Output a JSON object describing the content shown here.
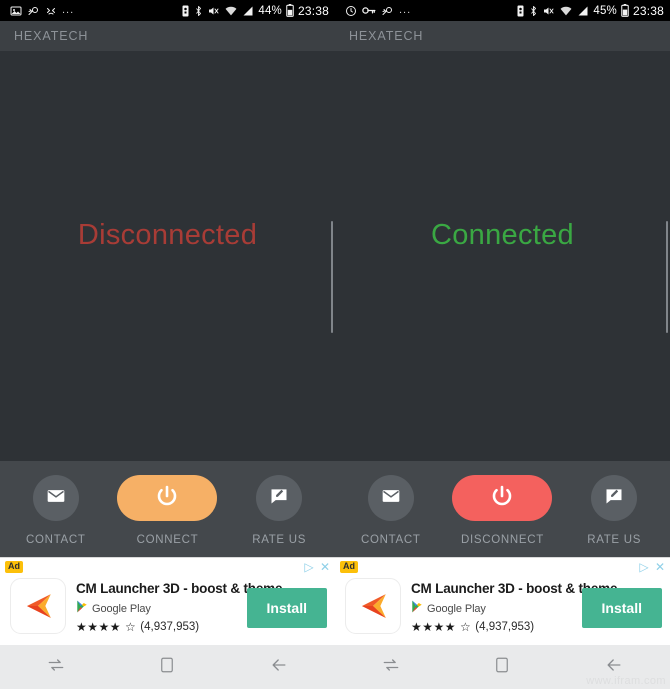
{
  "panes": [
    {
      "status_bar": {
        "left_icons": [
          "screenshot-icon",
          "mute-notification-icon",
          "face-icon"
        ],
        "overflow": "...",
        "right_icons": [
          "vibrate-icon",
          "bluetooth-icon",
          "speaker-mute-icon",
          "wifi-icon",
          "signal-icon"
        ],
        "battery_percent": "44%",
        "clock": "23:38"
      },
      "appbar": {
        "title": "HEXATECH"
      },
      "main": {
        "status_text": "Disconnected",
        "status_color": "#a83c36"
      },
      "actions": [
        {
          "label": "CONTACT",
          "icon": "envelope-icon",
          "style": "circle"
        },
        {
          "label": "CONNECT",
          "icon": "power-icon",
          "style": "pill",
          "color": "#f6b066"
        },
        {
          "label": "RATE US",
          "icon": "review-pencil-icon",
          "style": "circle"
        }
      ],
      "ad": {
        "badge": "Ad",
        "title": "CM Launcher 3D - boost & theme",
        "store": "Google Play",
        "stars": "★★★★",
        "half_star": "☆",
        "reviews": "(4,937,953)",
        "install_label": "Install",
        "adchoices_icon": "adchoices-triangle-icon",
        "close_icon": "close-icon"
      },
      "nav": [
        {
          "name": "recents-button",
          "icon": "recents-icon"
        },
        {
          "name": "home-button",
          "icon": "home-square-icon"
        },
        {
          "name": "back-button",
          "icon": "back-arrow-icon"
        }
      ]
    },
    {
      "status_bar": {
        "left_icons": [
          "alarm-clock-icon",
          "vpn-key-icon",
          "mute-notification-icon"
        ],
        "overflow": "...",
        "right_icons": [
          "vibrate-icon",
          "bluetooth-icon",
          "speaker-mute-icon",
          "wifi-icon",
          "signal-icon"
        ],
        "battery_percent": "45%",
        "clock": "23:38"
      },
      "appbar": {
        "title": "HEXATECH"
      },
      "main": {
        "status_text": "Connected",
        "status_color": "#3aa843"
      },
      "actions": [
        {
          "label": "CONTACT",
          "icon": "envelope-icon",
          "style": "circle"
        },
        {
          "label": "DISCONNECT",
          "icon": "power-icon",
          "style": "pill",
          "color": "#f4615e"
        },
        {
          "label": "RATE US",
          "icon": "review-pencil-icon",
          "style": "circle"
        }
      ],
      "ad": {
        "badge": "Ad",
        "title": "CM Launcher 3D - boost & theme",
        "store": "Google Play",
        "stars": "★★★★",
        "half_star": "☆",
        "reviews": "(4,937,953)",
        "install_label": "Install",
        "adchoices_icon": "adchoices-triangle-icon",
        "close_icon": "close-icon"
      },
      "nav": [
        {
          "name": "recents-button",
          "icon": "recents-icon"
        },
        {
          "name": "home-button",
          "icon": "home-square-icon"
        },
        {
          "name": "back-button",
          "icon": "back-arrow-icon"
        }
      ],
      "watermark": "www.ifram.com"
    }
  ]
}
